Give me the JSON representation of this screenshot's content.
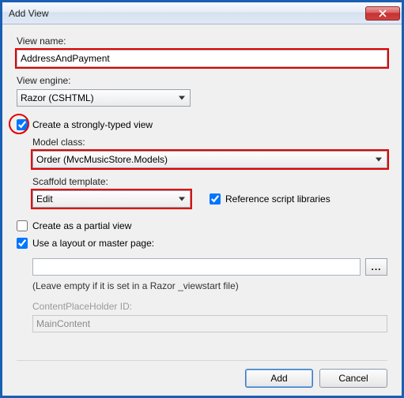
{
  "window": {
    "title": "Add View"
  },
  "fields": {
    "view_name": {
      "label": "View name:",
      "value": "AddressAndPayment"
    },
    "view_engine": {
      "label": "View engine:",
      "value": "Razor (CSHTML)"
    }
  },
  "strongly_typed": {
    "checkbox_label": "Create a strongly-typed view",
    "model_class": {
      "label": "Model class:",
      "value": "Order (MvcMusicStore.Models)"
    },
    "scaffold": {
      "label": "Scaffold template:",
      "value": "Edit"
    },
    "reference_scripts": {
      "label": "Reference script libraries"
    }
  },
  "partial": {
    "label": "Create as a partial view"
  },
  "layout": {
    "checkbox_label": "Use a layout or master page:",
    "path_value": "",
    "hint": "(Leave empty if it is set in a Razor _viewstart file)",
    "cph": {
      "label": "ContentPlaceHolder ID:",
      "value": "MainContent"
    },
    "browse": "..."
  },
  "buttons": {
    "add": "Add",
    "cancel": "Cancel"
  }
}
